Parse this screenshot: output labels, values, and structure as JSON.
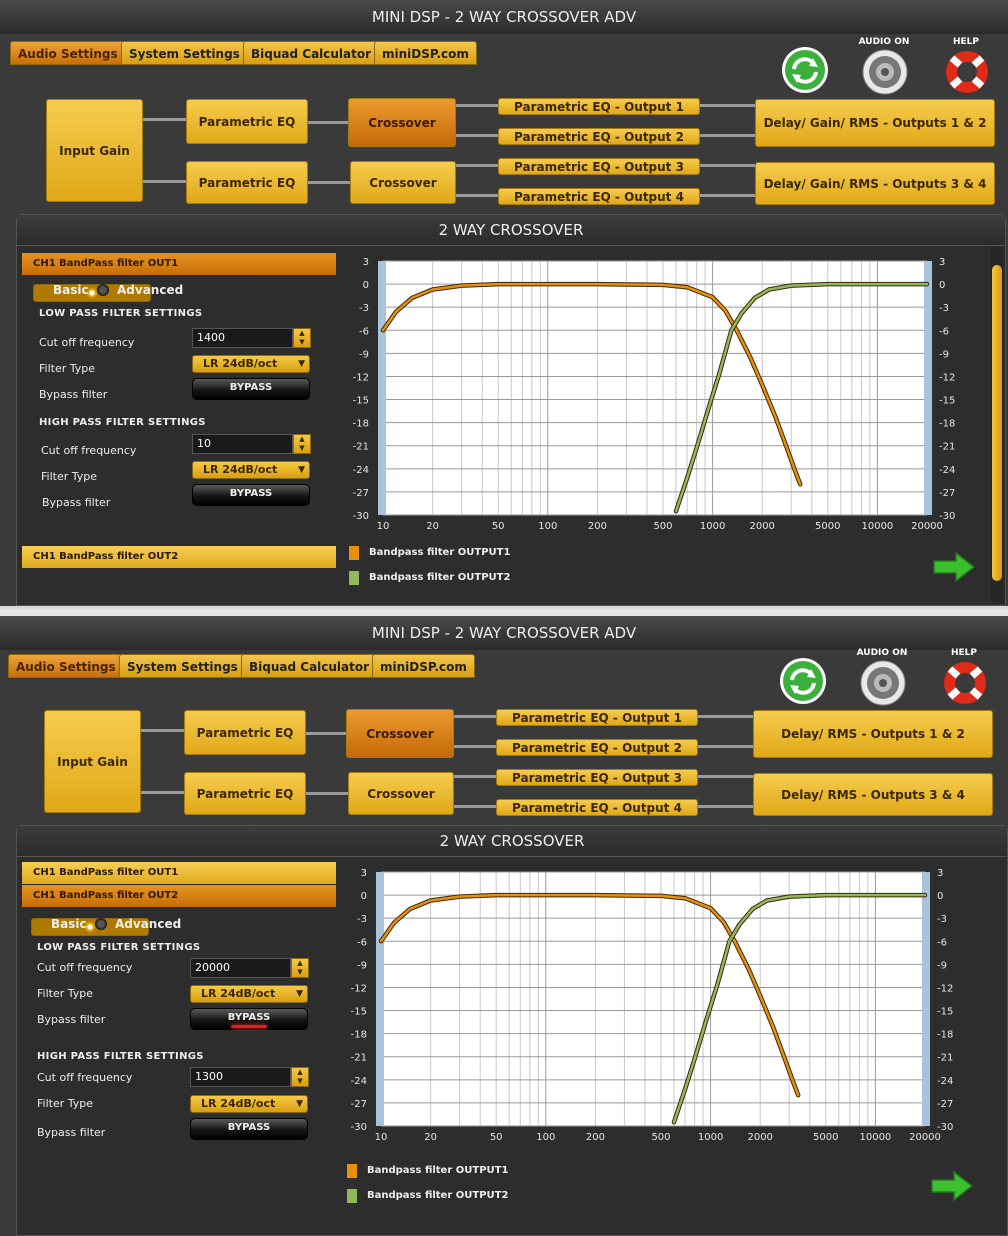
{
  "windows": [
    {
      "title": "MINI DSP - 2 WAY CROSSOVER ADV",
      "tabs": [
        "Audio Settings",
        "System Settings",
        "Biquad Calculator",
        "miniDSP.com"
      ],
      "icons": {
        "audio_label": "AUDIO ON",
        "help_label": "HELP"
      },
      "routing": {
        "input_gain": "Input Gain",
        "peq": [
          "Parametric EQ",
          "Parametric EQ"
        ],
        "crossover": [
          "Crossover",
          "Crossover"
        ],
        "outputs": [
          "Parametric EQ - Output 1",
          "Parametric EQ - Output 2",
          "Parametric EQ - Output 3",
          "Parametric EQ - Output 4"
        ],
        "delay": [
          "Delay/ Gain/ RMS - Outputs 1 & 2",
          "Delay/ Gain/ RMS - Outputs 3 & 4"
        ]
      },
      "panel_title": "2 WAY CROSSOVER",
      "filter_tabs": [
        "CH1 BandPass filter OUT1",
        "CH1 BandPass filter OUT2"
      ],
      "mode": {
        "basic": "Basic",
        "advanced": "Advanced"
      },
      "low_pass": {
        "heading": "LOW PASS FILTER SETTINGS",
        "cutoff_label": "Cut off frequency",
        "cutoff": "1400",
        "type_label": "Filter Type",
        "type": "LR 24dB/oct",
        "bypass_label": "Bypass filter",
        "bypass_btn": "BYPASS"
      },
      "high_pass": {
        "heading": "HIGH PASS FILTER SETTINGS",
        "cutoff_label": "Cut off frequency",
        "cutoff": "10",
        "type_label": "Filter Type",
        "type": "LR 24dB/oct",
        "bypass_label": "Bypass filter",
        "bypass_btn": "BYPASS"
      },
      "legend": [
        "Bandpass filter OUTPUT1",
        "Bandpass filter OUTPUT2"
      ]
    },
    {
      "title": "MINI DSP - 2 WAY CROSSOVER ADV",
      "tabs": [
        "Audio Settings",
        "System Settings",
        "Biquad Calculator",
        "miniDSP.com"
      ],
      "icons": {
        "audio_label": "AUDIO ON",
        "help_label": "HELP"
      },
      "routing": {
        "input_gain": "Input Gain",
        "peq": [
          "Parametric EQ",
          "Parametric EQ"
        ],
        "crossover": [
          "Crossover",
          "Crossover"
        ],
        "outputs": [
          "Parametric EQ - Output 1",
          "Parametric EQ - Output 2",
          "Parametric EQ - Output 3",
          "Parametric EQ - Output 4"
        ],
        "delay": [
          "Delay/ RMS - Outputs 1 & 2",
          "Delay/ RMS - Outputs 3 & 4"
        ]
      },
      "panel_title": "2 WAY CROSSOVER",
      "filter_tabs": [
        "CH1 BandPass filter OUT1",
        "CH1 BandPass filter OUT2"
      ],
      "mode": {
        "basic": "Basic",
        "advanced": "Advanced"
      },
      "low_pass": {
        "heading": "LOW PASS FILTER SETTINGS",
        "cutoff_label": "Cut off frequency",
        "cutoff": "20000",
        "type_label": "Filter Type",
        "type": "LR 24dB/oct",
        "bypass_label": "Bypass filter",
        "bypass_btn": "BYPASS"
      },
      "high_pass": {
        "heading": "HIGH PASS FILTER SETTINGS",
        "cutoff_label": "Cut off frequency",
        "cutoff": "1300",
        "type_label": "Filter Type",
        "type": "LR 24dB/oct",
        "bypass_label": "Bypass filter",
        "bypass_btn": "BYPASS"
      },
      "legend": [
        "Bandpass filter OUTPUT1",
        "Bandpass filter OUTPUT2"
      ]
    }
  ],
  "chart_data": [
    {
      "type": "line",
      "x_scale": "log",
      "xlim": [
        10,
        20000
      ],
      "ylim": [
        -30,
        3
      ],
      "x_ticks": [
        "10",
        "20",
        "50",
        "100",
        "200",
        "500",
        "1000",
        "2000",
        "5000",
        "10000",
        "20000"
      ],
      "y_ticks": [
        "3",
        "0",
        "-3",
        "-6",
        "-9",
        "-12",
        "-15",
        "-18",
        "-21",
        "-24",
        "-27",
        "-30"
      ],
      "grid": true,
      "series": [
        {
          "name": "Bandpass filter OUTPUT1",
          "color": "#e8900c",
          "x": [
            10,
            12,
            15,
            20,
            30,
            50,
            100,
            200,
            500,
            700,
            1000,
            1200,
            1400,
            1700,
            2000,
            2400,
            2800,
            3200,
            3400
          ],
          "y": [
            -6.0,
            -3.6,
            -1.8,
            -0.7,
            -0.2,
            0,
            0,
            0,
            -0.1,
            -0.4,
            -1.7,
            -3.5,
            -6.0,
            -9.6,
            -13.1,
            -17.2,
            -21.1,
            -24.5,
            -26.0
          ]
        },
        {
          "name": "Bandpass filter OUTPUT2",
          "color": "#93b85a",
          "x": [
            600,
            700,
            800,
            950,
            1100,
            1300,
            1500,
            1800,
            2200,
            3000,
            5000,
            10000,
            20000
          ],
          "y": [
            -29.5,
            -25.2,
            -21.3,
            -16.0,
            -11.6,
            -6.0,
            -3.8,
            -1.8,
            -0.7,
            -0.2,
            0,
            0,
            0
          ]
        }
      ]
    },
    {
      "type": "line",
      "x_scale": "log",
      "xlim": [
        10,
        20000
      ],
      "ylim": [
        -30,
        3
      ],
      "x_ticks": [
        "10",
        "20",
        "50",
        "100",
        "200",
        "500",
        "1000",
        "2000",
        "5000",
        "10000",
        "20000"
      ],
      "y_ticks": [
        "3",
        "0",
        "-3",
        "-6",
        "-9",
        "-12",
        "-15",
        "-18",
        "-21",
        "-24",
        "-27",
        "-30"
      ],
      "grid": true,
      "series": [
        {
          "name": "Bandpass filter OUTPUT1",
          "color": "#e8900c",
          "x": [
            10,
            12,
            15,
            20,
            30,
            50,
            100,
            200,
            500,
            700,
            1000,
            1200,
            1400,
            1700,
            2000,
            2400,
            2800,
            3200,
            3400
          ],
          "y": [
            -6.0,
            -3.6,
            -1.8,
            -0.7,
            -0.2,
            0,
            0,
            0,
            -0.1,
            -0.4,
            -1.7,
            -3.5,
            -6.0,
            -9.6,
            -13.1,
            -17.2,
            -21.1,
            -24.5,
            -26.0
          ]
        },
        {
          "name": "Bandpass filter OUTPUT2",
          "color": "#93b85a",
          "x": [
            600,
            700,
            800,
            950,
            1100,
            1300,
            1500,
            1800,
            2200,
            3000,
            5000,
            10000,
            20000
          ],
          "y": [
            -29.5,
            -25.2,
            -21.3,
            -16.0,
            -11.6,
            -6.0,
            -3.8,
            -1.8,
            -0.7,
            -0.2,
            0,
            0,
            0
          ]
        }
      ]
    }
  ],
  "colors": {
    "accent": "#e9ad22",
    "active": "#d4790f",
    "background": "#3a3a3a",
    "plot_bg": "#ffffff",
    "grid": "#c8c8c8"
  }
}
